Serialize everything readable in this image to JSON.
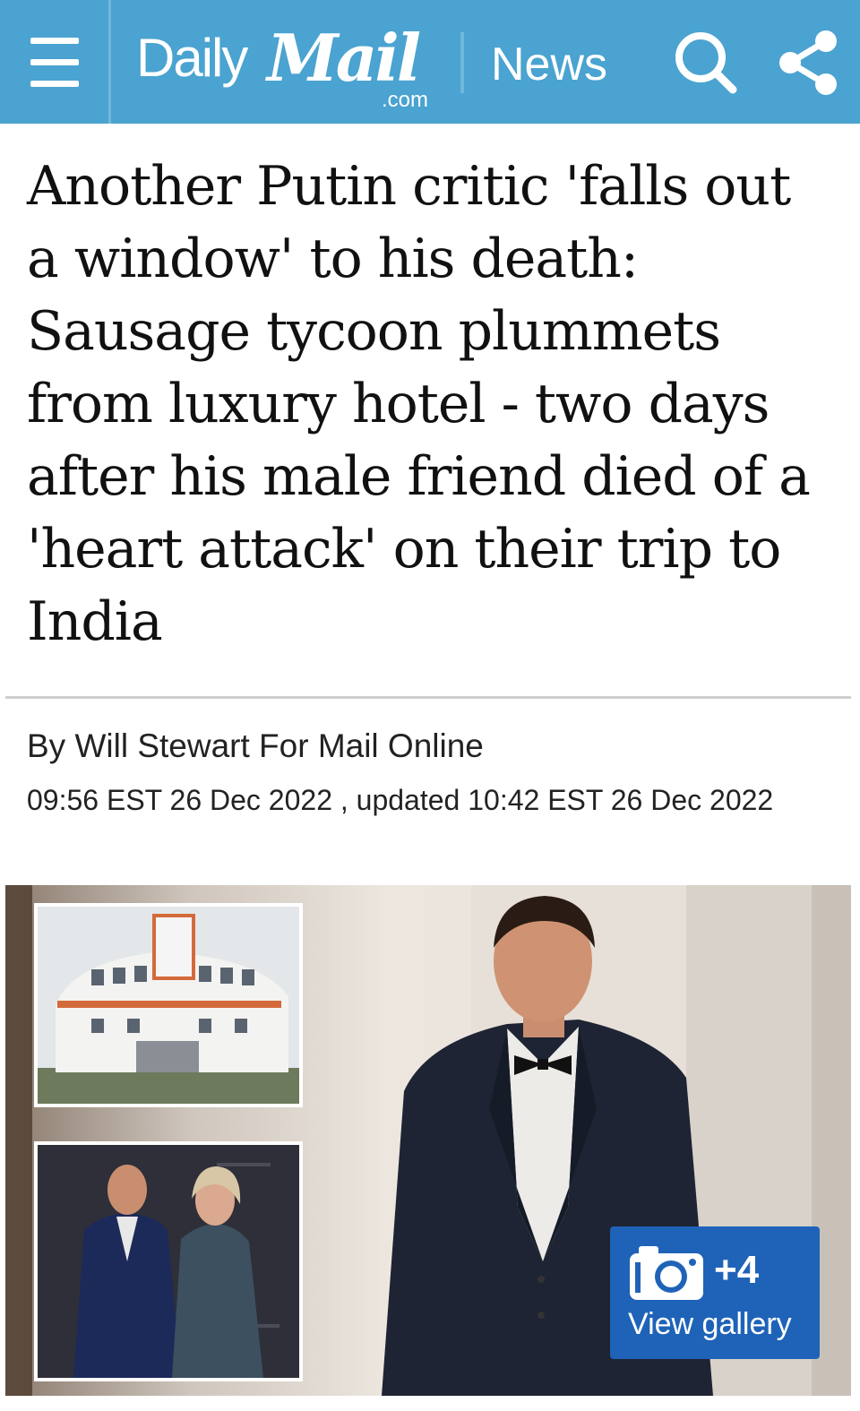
{
  "header": {
    "brand_daily": "Daily",
    "brand_mail": "Mail",
    "brand_com": ".com",
    "section": "News",
    "bar_color": "#4aa3d0",
    "icons": [
      "menu-icon",
      "search-icon",
      "share-icon"
    ]
  },
  "article": {
    "headline": "Another Putin critic 'falls out a window' to his death: Sausage tycoon plummets from luxury hotel - two days after his male friend died of a 'heart attack' on their trip to India",
    "byline": "By Will Stewart For Mail Online",
    "dateline": "09:56 EST 26 Dec 2022 , updated 10:42 EST 26 Dec 2022"
  },
  "gallery": {
    "count": "+4",
    "label": "View gallery",
    "button_color": "#1f63b8",
    "icon": "camera-icon"
  }
}
